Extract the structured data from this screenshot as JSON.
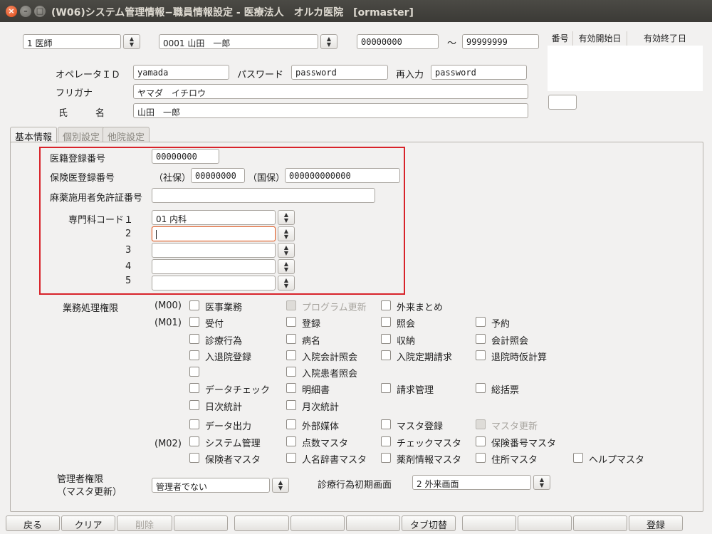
{
  "window": {
    "title": "(W06)システム管理情報−職員情報設定 - 医療法人　オルカ医院　[ormaster]"
  },
  "top": {
    "occupation": "1 医師",
    "staff": "0001 山田　一郎",
    "range_from": "00000000",
    "range_sep": "〜",
    "range_to": "99999999"
  },
  "history": {
    "headers": [
      "番号",
      "有効開始日",
      "有効終了日"
    ],
    "field_value": ""
  },
  "account": {
    "operator_label": "オペレータＩＤ",
    "operator_value": "yamada",
    "password_label": "パスワード",
    "password_value": "password",
    "reenter_label": "再入力",
    "reenter_value": "password",
    "furigana_label": "フリガナ",
    "furigana_value": "ヤマダ　イチロウ",
    "name_label": "氏　　　名",
    "name_value": "山田　一郎"
  },
  "tabs": [
    "基本情報",
    "個別設定",
    "他院設定"
  ],
  "basic": {
    "reg_label": "医籍登録番号",
    "reg_value": "00000000",
    "ins_label": "保険医登録番号",
    "shaho_label": "（社保）",
    "shaho_value": "00000000",
    "kokuho_label": "（国保）",
    "kokuho_value": "000000000000",
    "narc_label": "麻薬施用者免許証番号",
    "narc_value": "",
    "spec_label": "専門科コード１",
    "specs": [
      {
        "num": "",
        "value": "01 内科"
      },
      {
        "num": "2",
        "value": ""
      },
      {
        "num": "3",
        "value": ""
      },
      {
        "num": "4",
        "value": ""
      },
      {
        "num": "5",
        "value": ""
      }
    ]
  },
  "perm": {
    "label": "業務処理権限",
    "m00": "(M00)",
    "m01": "(M01)",
    "m02": "(M02)",
    "items": [
      "医事業務",
      "プログラム更新",
      "外来まとめ",
      "受付",
      "登録",
      "照会",
      "予約",
      "診療行為",
      "病名",
      "収納",
      "会計照会",
      "入退院登録",
      "入院会計照会",
      "入院定期請求",
      "退院時仮計算",
      "入院患者照会",
      "データチェック",
      "明細書",
      "請求管理",
      "総括票",
      "日次統計",
      "月次統計",
      "データ出力",
      "外部媒体",
      "マスタ登録",
      "マスタ更新",
      "システム管理",
      "点数マスタ",
      "チェックマスタ",
      "保険番号マスタ",
      "保険者マスタ",
      "人名辞書マスタ",
      "薬剤情報マスタ",
      "住所マスタ",
      "ヘルプマスタ"
    ]
  },
  "admin": {
    "label1": "管理者権限",
    "label2": "（マスタ更新）",
    "value": "管理者でない"
  },
  "initscreen": {
    "label": "診療行為初期画面",
    "value": "2 外来画面"
  },
  "footer": {
    "back": "戻る",
    "clear": "クリア",
    "delete": "削除",
    "tab_switch": "タブ切替",
    "register": "登録"
  }
}
